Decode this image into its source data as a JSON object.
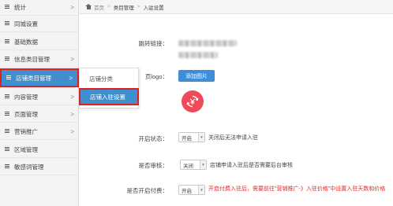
{
  "sidebar": {
    "items": [
      {
        "label": "统计",
        "arrow": ">"
      },
      {
        "label": "同城设置",
        "arrow": ""
      },
      {
        "label": "基础数据",
        "arrow": ""
      },
      {
        "label": "信息类目管理",
        "arrow": ">"
      },
      {
        "label": "店铺类目管理",
        "arrow": ">"
      },
      {
        "label": "内容管理",
        "arrow": ">"
      },
      {
        "label": "页面管理",
        "arrow": ">"
      },
      {
        "label": "营销推广",
        "arrow": ">"
      },
      {
        "label": "区域管理",
        "arrow": ""
      },
      {
        "label": "敏感词管理",
        "arrow": ""
      }
    ]
  },
  "flyout": {
    "items": [
      {
        "label": "店铺分类"
      },
      {
        "label": "店铺入驻设置"
      }
    ]
  },
  "breadcrumb": {
    "home": "首页",
    "sep": ">",
    "level1": "类目管理",
    "current": "入驻设置"
  },
  "form": {
    "link_label": "跳转链接：",
    "logo_label": "页logo：",
    "add_image_button": "添加图片",
    "logo_icon": "yen-exchange-icon",
    "open_status_label": "开启状态：",
    "open_status_value": "开启",
    "open_status_desc": "关闭后无法申请入驻",
    "review_label": "是否审核：",
    "review_value": "关闭",
    "review_desc": "店铺申请入驻后是否需要后台审核",
    "paid_label": "是否开启付费：",
    "paid_value": "开启",
    "paid_desc": "开启付费入驻后，需要前往\"营销推广-》入驻价格\"中设置入驻天数和价格"
  },
  "colors": {
    "accent": "#3f8fcf",
    "highlight_border": "#e02020",
    "logo_bg": "#f04a5a",
    "warning_text": "#e02a2a"
  }
}
